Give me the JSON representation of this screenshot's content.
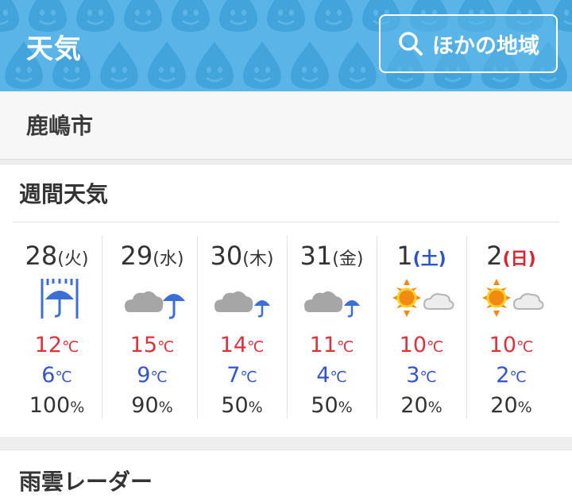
{
  "header": {
    "title": "天気",
    "search_label": "ほかの地域",
    "colors": {
      "bg": "#5ab4e8",
      "pattern": "#3f9ed6"
    }
  },
  "location": {
    "name": "鹿嶋市"
  },
  "weekly": {
    "title": "週間天気",
    "temp_unit": "℃",
    "pop_unit": "%",
    "days": [
      {
        "day": "28",
        "weekday": "(火)",
        "icon": "rain-umbrella-icon",
        "high": "12",
        "low": "6",
        "pop": "100"
      },
      {
        "day": "29",
        "weekday": "(水)",
        "icon": "cloudy-rain-icon",
        "high": "15",
        "low": "9",
        "pop": "90"
      },
      {
        "day": "30",
        "weekday": "(木)",
        "icon": "cloudy-occasional-rain-icon",
        "high": "14",
        "low": "7",
        "pop": "50"
      },
      {
        "day": "31",
        "weekday": "(金)",
        "icon": "cloudy-occasional-rain-icon",
        "high": "11",
        "low": "4",
        "pop": "50"
      },
      {
        "day": "1",
        "weekday": "(土)",
        "icon": "sunny-then-cloudy-icon",
        "high": "10",
        "low": "3",
        "pop": "20"
      },
      {
        "day": "2",
        "weekday": "(日)",
        "icon": "sunny-then-cloudy-icon",
        "high": "10",
        "low": "2",
        "pop": "20"
      }
    ]
  },
  "radar": {
    "title": "雨雲レーダー"
  }
}
